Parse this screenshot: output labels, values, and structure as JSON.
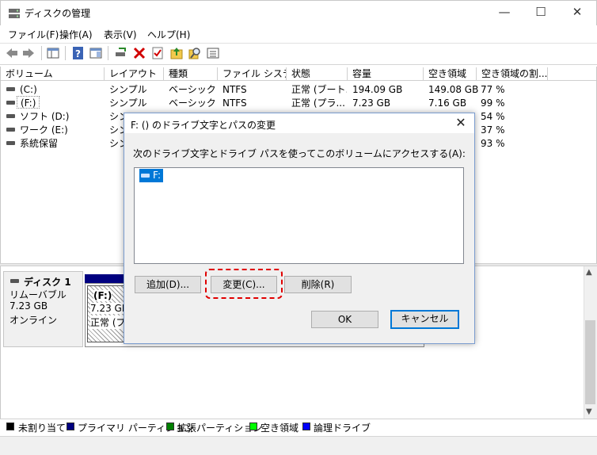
{
  "window": {
    "title": "ディスクの管理",
    "minimize_glyph": "—",
    "maximize_glyph": "☐",
    "close_glyph": "✕"
  },
  "menu": [
    "ファイル(F)",
    "操作(A)",
    "表示(V)",
    "ヘルプ(H)"
  ],
  "toolbar_icons": [
    "back-icon",
    "forward-icon",
    "console-tree-icon",
    "help-icon",
    "details-pane-icon",
    "connect-drive-icon",
    "delete-icon",
    "properties-icon",
    "up-folder-icon",
    "search-icon",
    "list-icon"
  ],
  "columns": [
    "ボリューム",
    "レイアウト",
    "種類",
    "ファイル システム",
    "状態",
    "容量",
    "空き領域",
    "空き領域の割..."
  ],
  "volumes": [
    {
      "name": "(C:)",
      "layout": "シンプル",
      "type": "ベーシック",
      "fs": "NTFS",
      "status": "正常 (ブート...",
      "capacity": "194.09 GB",
      "free": "149.08 GB",
      "pct": "77 %"
    },
    {
      "name": "(F:)",
      "layout": "シンプル",
      "type": "ベーシック",
      "fs": "NTFS",
      "status": "正常 (プラ...",
      "capacity": "7.23 GB",
      "free": "7.16 GB",
      "pct": "99 %"
    },
    {
      "name": "ソフト (D:)",
      "layout": "シン",
      "type": "",
      "fs": "",
      "status": "",
      "capacity": "",
      "free": "",
      "pct": "54 %"
    },
    {
      "name": "ワーク (E:)",
      "layout": "シン",
      "type": "",
      "fs": "",
      "status": "",
      "capacity": "",
      "free": "",
      "pct": "37 %"
    },
    {
      "name": "系統保留",
      "layout": "シン",
      "type": "",
      "fs": "",
      "status": "",
      "capacity": "",
      "free": "",
      "pct": "93 %"
    }
  ],
  "disk": {
    "name": "ディスク 1",
    "kind": "リムーバブル",
    "size": "7.23 GB",
    "state": "オンライン",
    "partition": {
      "name": "(F:)",
      "size": "7.23 GB",
      "status": "正常 (プ"
    }
  },
  "legend": [
    {
      "label": "未割り当て",
      "color": "#000000"
    },
    {
      "label": "プライマリ パーティション",
      "color": "#000080"
    },
    {
      "label": "拡張パーティション",
      "color": "#008000"
    },
    {
      "label": "空き領域",
      "color": "#00ff00"
    },
    {
      "label": "論理ドライブ",
      "color": "#0000ff"
    }
  ],
  "dialog": {
    "title": "F: () のドライブ文字とパスの変更",
    "close_glyph": "✕",
    "instruction": "次のドライブ文字とドライブ パスを使ってこのボリュームにアクセスする(A):",
    "list_item": "F:",
    "add": "追加(D)...",
    "change": "変更(C)...",
    "remove": "削除(R)",
    "ok": "OK",
    "cancel": "キャンセル"
  },
  "colors": {
    "accent": "#0078d7",
    "highlight": "#e00000",
    "primary_partition": "#000080"
  }
}
